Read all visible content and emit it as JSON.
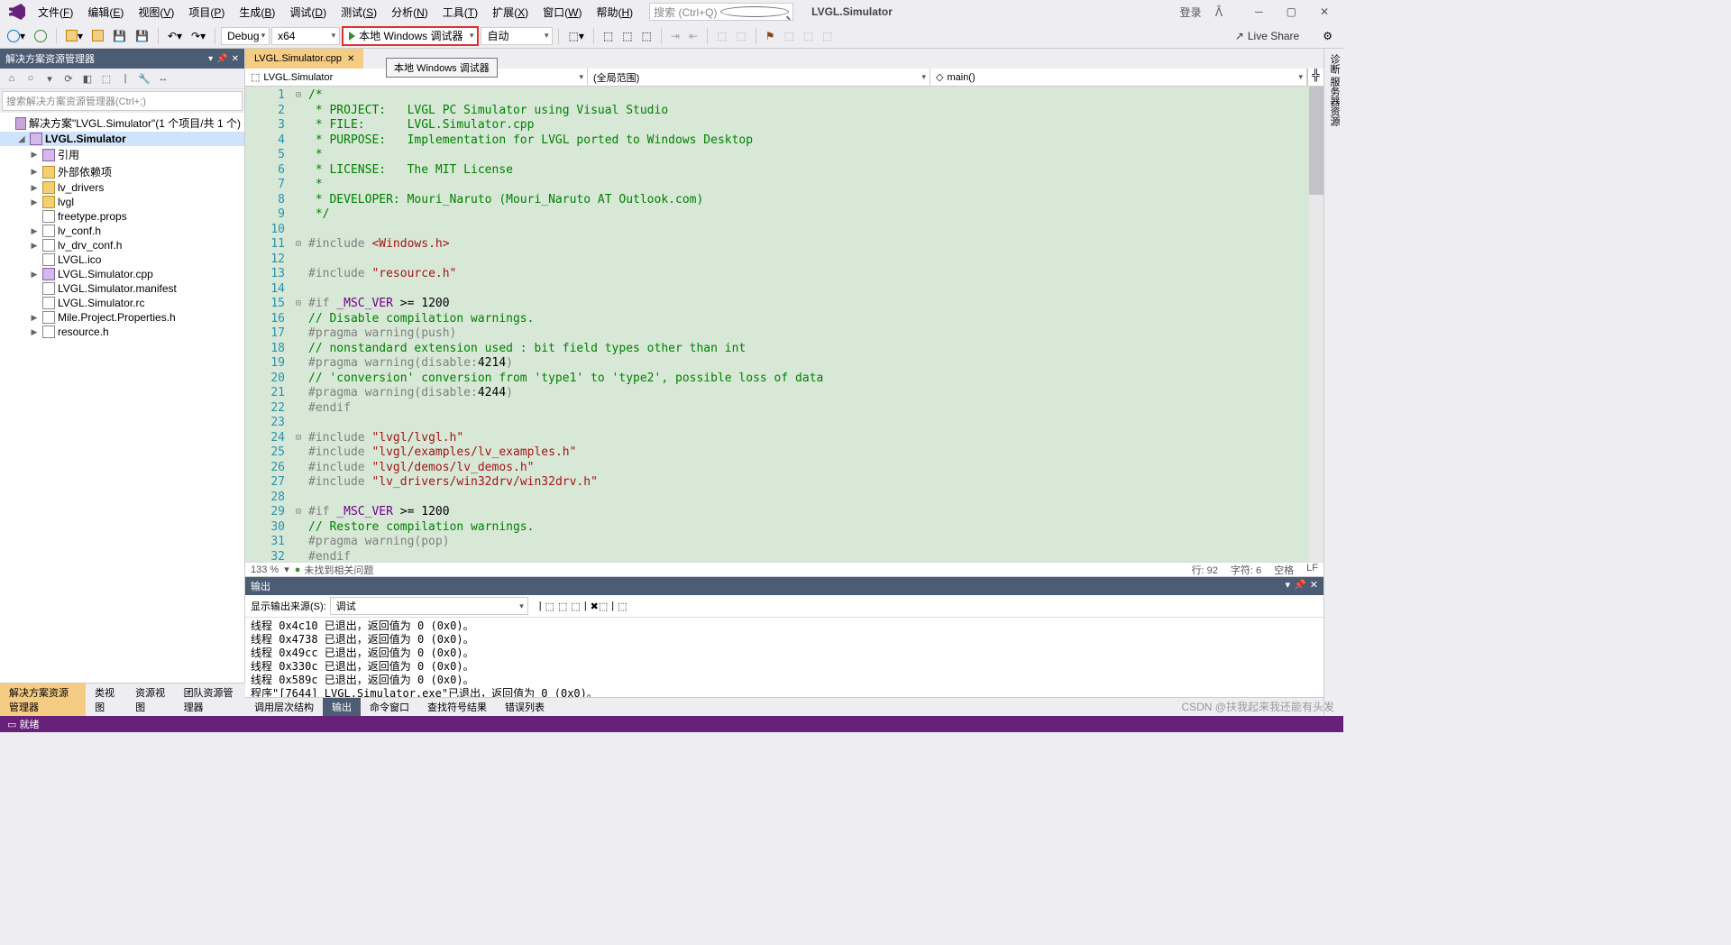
{
  "menus": [
    "文件(F)",
    "编辑(E)",
    "视图(V)",
    "项目(P)",
    "生成(B)",
    "调试(D)",
    "测试(S)",
    "分析(N)",
    "工具(T)",
    "扩展(X)",
    "窗口(W)",
    "帮助(H)"
  ],
  "search_placeholder": "搜索 (Ctrl+Q)",
  "title": "LVGL.Simulator",
  "login": "登录",
  "config": "Debug",
  "platform": "x64",
  "debugger": "本地 Windows 调试器",
  "debugger_tip": "本地 Windows 调试器",
  "auto": "自动",
  "live_share": "Live Share",
  "sln_panel": {
    "title": "解决方案资源管理器",
    "search": "搜索解决方案资源管理器(Ctrl+;)",
    "root": "解决方案\"LVGL.Simulator\"(1 个项目/共 1 个)",
    "project": "LVGL.Simulator",
    "items": [
      {
        "t": "引用",
        "exp": "▶",
        "d": 2,
        "ico": "fi-cpp"
      },
      {
        "t": "外部依赖项",
        "exp": "▶",
        "d": 2,
        "ico": "fi-folder"
      },
      {
        "t": "lv_drivers",
        "exp": "▶",
        "d": 2,
        "ico": "fi-folder"
      },
      {
        "t": "lvgl",
        "exp": "▶",
        "d": 2,
        "ico": "fi-folder"
      },
      {
        "t": "freetype.props",
        "exp": "",
        "d": 2,
        "ico": "fi-file"
      },
      {
        "t": "lv_conf.h",
        "exp": "▶",
        "d": 2,
        "ico": "fi-file"
      },
      {
        "t": "lv_drv_conf.h",
        "exp": "▶",
        "d": 2,
        "ico": "fi-file"
      },
      {
        "t": "LVGL.ico",
        "exp": "",
        "d": 2,
        "ico": "fi-file"
      },
      {
        "t": "LVGL.Simulator.cpp",
        "exp": "▶",
        "d": 2,
        "ico": "fi-cpp"
      },
      {
        "t": "LVGL.Simulator.manifest",
        "exp": "",
        "d": 2,
        "ico": "fi-file"
      },
      {
        "t": "LVGL.Simulator.rc",
        "exp": "",
        "d": 2,
        "ico": "fi-file"
      },
      {
        "t": "Mile.Project.Properties.h",
        "exp": "▶",
        "d": 2,
        "ico": "fi-file"
      },
      {
        "t": "resource.h",
        "exp": "▶",
        "d": 2,
        "ico": "fi-file"
      }
    ]
  },
  "tab": "LVGL.Simulator.cpp",
  "nav": {
    "left": "LVGL.Simulator",
    "mid": "(全局范围)",
    "right": "main()"
  },
  "zoom": "133 %",
  "issues": "未找到相关问题",
  "pos": {
    "line": "行: 92",
    "col": "字符: 6",
    "ins": "空格",
    "crlf": "LF"
  },
  "output": {
    "title": "输出",
    "src_label": "显示输出来源(S):",
    "src": "调试",
    "lines": [
      "线程 0x4c10 已退出，返回值为 0 (0x0)。",
      "线程 0x4738 已退出，返回值为 0 (0x0)。",
      "线程 0x49cc 已退出，返回值为 0 (0x0)。",
      "线程 0x330c 已退出，返回值为 0 (0x0)。",
      "线程 0x589c 已退出，返回值为 0 (0x0)。",
      "程序\"[7644] LVGL.Simulator.exe\"已退出，返回值为 0 (0x0)。"
    ]
  },
  "btabs_left": [
    "解决方案资源管理器",
    "类视图",
    "资源视图",
    "团队资源管理器"
  ],
  "btabs_right": [
    "调用层次结构",
    "输出",
    "命令窗口",
    "查找符号结果",
    "错误列表"
  ],
  "status": "就绪",
  "rside": "诊断 服务器资源",
  "watermark": "CSDN @扶我起来我还能有头发",
  "code": [
    {
      "n": 1,
      "f": "⊟",
      "h": "<span class='c-comment'>/*</span>"
    },
    {
      "n": 2,
      "h": "<span class='c-comment'> * PROJECT:   LVGL PC Simulator using Visual Studio</span>"
    },
    {
      "n": 3,
      "h": "<span class='c-comment'> * FILE:      LVGL.Simulator.cpp</span>"
    },
    {
      "n": 4,
      "h": "<span class='c-comment'> * PURPOSE:   Implementation for LVGL ported to Windows Desktop</span>"
    },
    {
      "n": 5,
      "h": "<span class='c-comment'> *</span>"
    },
    {
      "n": 6,
      "h": "<span class='c-comment'> * LICENSE:   The MIT License</span>"
    },
    {
      "n": 7,
      "h": "<span class='c-comment'> *</span>"
    },
    {
      "n": 8,
      "h": "<span class='c-comment'> * DEVELOPER: Mouri_Naruto (Mouri_Naruto AT Outlook.com)</span>"
    },
    {
      "n": 9,
      "h": "<span class='c-comment'> */</span>"
    },
    {
      "n": 10,
      "h": ""
    },
    {
      "n": 11,
      "f": "⊟",
      "h": "<span class='c-pp'>#include</span> <span class='c-str'>&lt;Windows.h&gt;</span>"
    },
    {
      "n": 12,
      "h": ""
    },
    {
      "n": 13,
      "h": "<span class='c-pp'>#include</span> <span class='c-str'>\"resource.h\"</span>"
    },
    {
      "n": 14,
      "h": ""
    },
    {
      "n": 15,
      "f": "⊟",
      "h": "<span class='c-pp'>#if</span> <span class='c-macro'>_MSC_VER</span> &gt;= 1200"
    },
    {
      "n": 16,
      "h": "<span class='c-comment'>// Disable compilation warnings.</span>"
    },
    {
      "n": 17,
      "h": "<span class='c-pp'>#pragma warning(push)</span>"
    },
    {
      "n": 18,
      "h": "<span class='c-comment'>// nonstandard extension used : bit field types other than int</span>"
    },
    {
      "n": 19,
      "h": "<span class='c-pp'>#pragma warning(disable:</span>4214<span class='c-pp'>)</span>"
    },
    {
      "n": 20,
      "h": "<span class='c-comment'>// 'conversion' conversion from 'type1' to 'type2', possible loss of data</span>"
    },
    {
      "n": 21,
      "h": "<span class='c-pp'>#pragma warning(disable:</span>4244<span class='c-pp'>)</span>"
    },
    {
      "n": 22,
      "h": "<span class='c-pp'>#endif</span>"
    },
    {
      "n": 23,
      "h": ""
    },
    {
      "n": 24,
      "f": "⊟",
      "h": "<span class='c-pp'>#include</span> <span class='c-str'>\"lvgl/lvgl.h\"</span>"
    },
    {
      "n": 25,
      "h": "<span class='c-pp'>#include</span> <span class='c-str'>\"lvgl/examples/lv_examples.h\"</span>"
    },
    {
      "n": 26,
      "h": "<span class='c-pp'>#include</span> <span class='c-str'>\"lvgl/demos/lv_demos.h\"</span>"
    },
    {
      "n": 27,
      "h": "<span class='c-pp'>#include</span> <span class='c-str'>\"lv_drivers/win32drv/win32drv.h\"</span>"
    },
    {
      "n": 28,
      "h": ""
    },
    {
      "n": 29,
      "f": "⊟",
      "h": "<span class='c-pp'>#if</span> <span class='c-macro'>_MSC_VER</span> &gt;= 1200"
    },
    {
      "n": 30,
      "h": "<span class='c-comment'>// Restore compilation warnings.</span>"
    },
    {
      "n": 31,
      "h": "<span class='c-pp'>#pragma warning(pop)</span>"
    },
    {
      "n": 32,
      "h": "<span class='c-pp'>#endif</span>"
    }
  ]
}
